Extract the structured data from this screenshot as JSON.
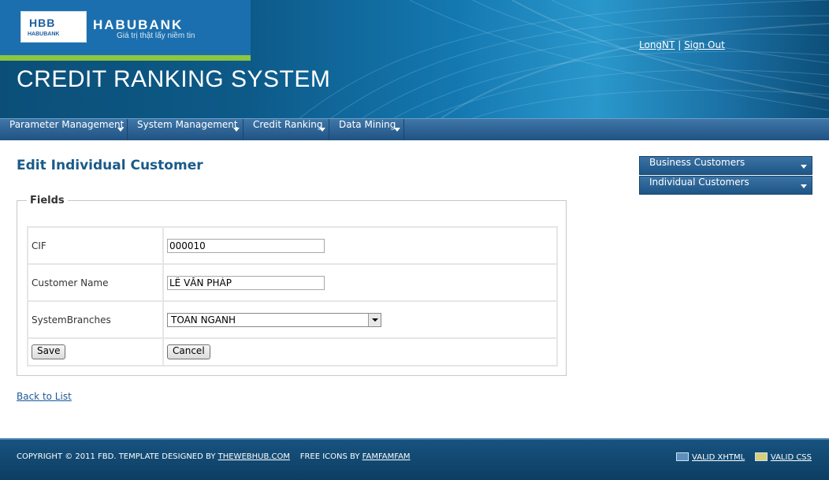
{
  "header": {
    "logo_text": "HBB",
    "logo_subtext": "HABUBANK",
    "brand_name": "HABUBANK",
    "brand_slogan": "Giá trị thật lấy niềm tin",
    "system_title": "CREDIT RANKING SYSTEM",
    "user": "LongNT",
    "separator": "|",
    "sign_out": "Sign Out"
  },
  "nav": {
    "items": [
      {
        "label": "Parameter Management"
      },
      {
        "label": "System Management"
      },
      {
        "label": "Credit Ranking"
      },
      {
        "label": "Data Mining"
      }
    ]
  },
  "main": {
    "page_title": "Edit Individual Customer",
    "fieldset_legend": "Fields",
    "fields": [
      {
        "label": "CIF",
        "value": "000010"
      },
      {
        "label": "Customer Name",
        "value": "LÊ VĂN PHÁP"
      },
      {
        "label": "SystemBranches",
        "value": "TOAN NGANH"
      }
    ],
    "save_label": "Save",
    "cancel_label": "Cancel",
    "back_link": "Back to List"
  },
  "sidebar": {
    "items": [
      {
        "label": "Business Customers"
      },
      {
        "label": "Individual Customers"
      }
    ]
  },
  "footer": {
    "copyright": "COPYRIGHT © 2011 FBD. TEMPLATE DESIGNED BY ",
    "designer_link": "THEWEBHUB.COM",
    "icons_text": "FREE ICONS BY ",
    "icons_link": "FAMFAMFAM",
    "valid_xhtml": "VALID XHTML",
    "valid_css": "VALID CSS"
  },
  "colors": {
    "header_bg": "#0d5a88",
    "accent_green": "#8dc63f",
    "nav_bg": "#2a5f90",
    "title_blue": "#1a5a8a"
  }
}
